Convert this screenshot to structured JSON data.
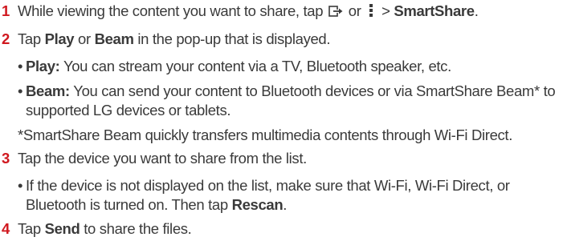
{
  "steps": [
    {
      "num": "1",
      "text_before": "While viewing the content you want to share, tap",
      "text_or": "or",
      "text_gt": ">",
      "bold_end": "SmartShare",
      "text_end": "."
    },
    {
      "num": "2",
      "text1": "Tap",
      "bold1": "Play",
      "text2": "or",
      "bold2": "Beam",
      "text3": "in the pop-up that is displayed."
    },
    {
      "num": "3",
      "text": "Tap the device you want to share from the list."
    },
    {
      "num": "4",
      "text1": "Tap",
      "bold1": "Send",
      "text2": "to share the files."
    }
  ],
  "bullets": {
    "play": {
      "label": "Play:",
      "text": "You can stream your content via a TV, Bluetooth speaker, etc."
    },
    "beam": {
      "label": "Beam:",
      "text_line1": "You can send your content to Bluetooth devices or via SmartShare Beam* to",
      "text_line2": "supported LG devices or tablets.",
      "footnote": "*SmartShare Beam quickly transfers multimedia contents through Wi-Fi Direct."
    },
    "device": {
      "text_line1": "If the device is not displayed on the list, make sure that Wi-Fi, Wi-Fi Direct, or",
      "text_line2_before": "Bluetooth is turned on. Then tap",
      "bold": "Rescan",
      "text_line2_after": "."
    }
  },
  "bullet_char": "•",
  "icons": [
    "share-icon",
    "menu-icon"
  ],
  "colors": {
    "step_number": "#d0181f",
    "text": "#3a3a3a"
  }
}
